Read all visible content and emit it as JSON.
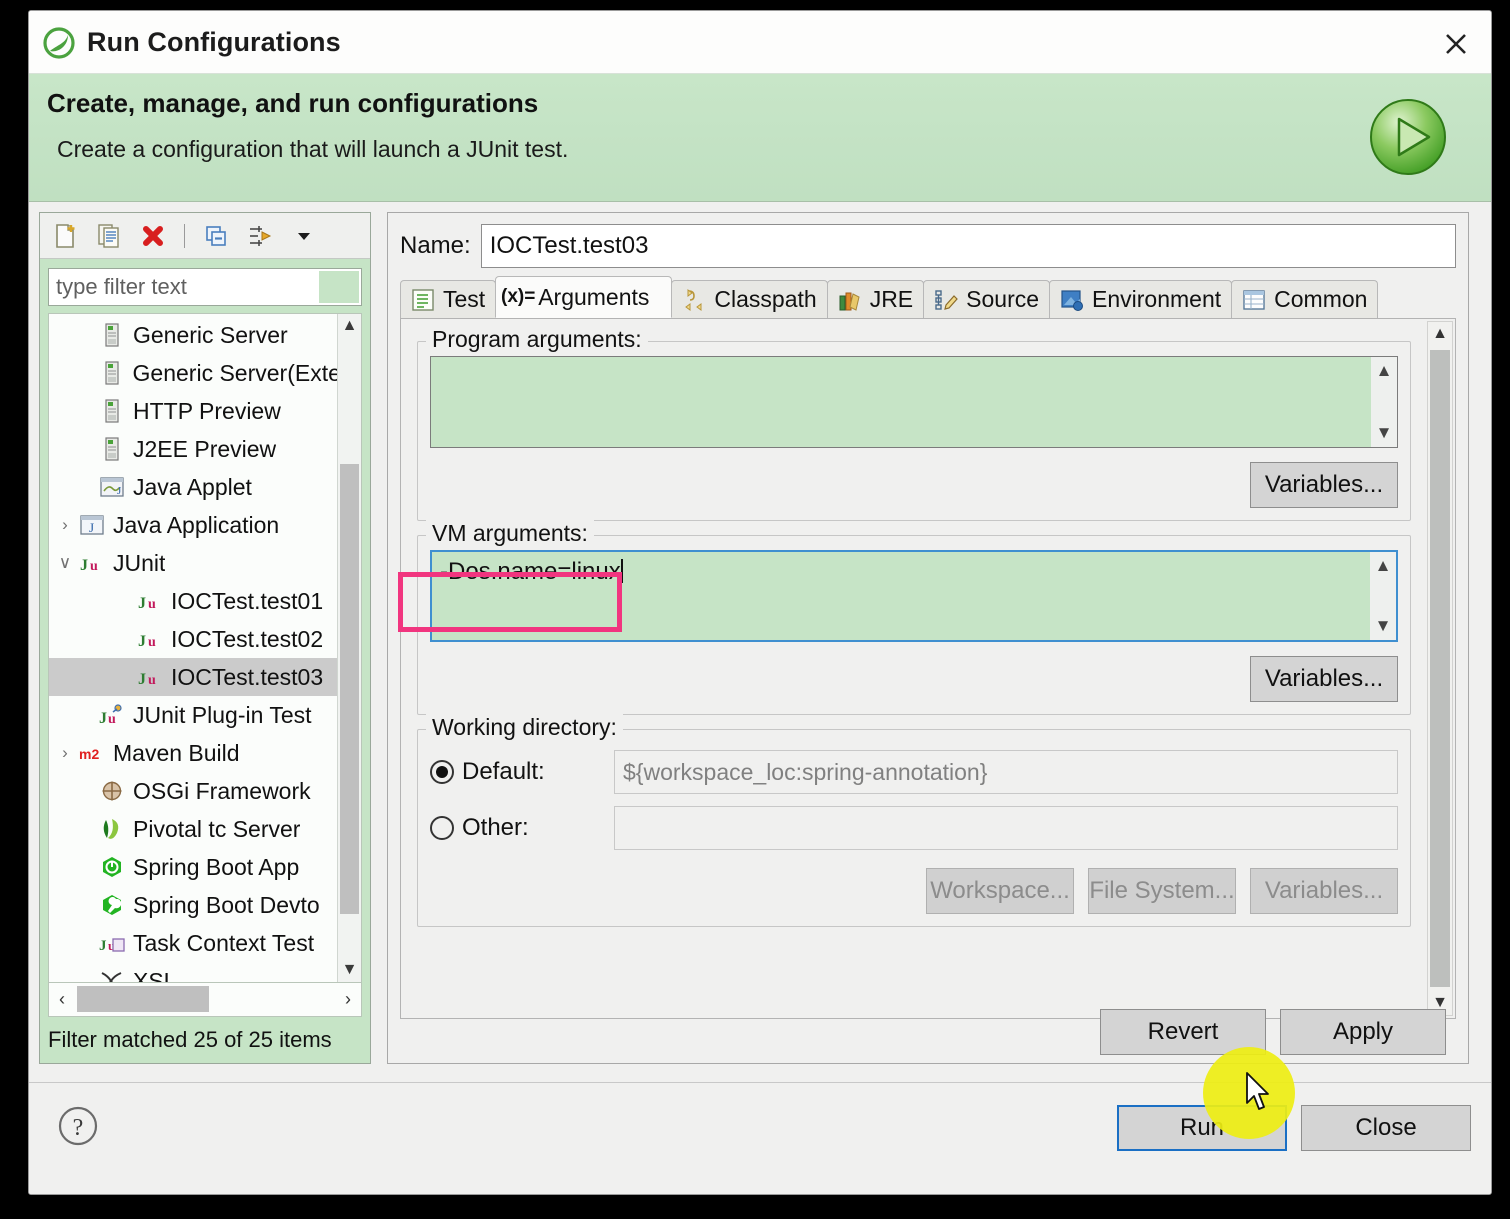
{
  "window": {
    "title": "Run Configurations",
    "logo_icon": "spring-leaf-icon",
    "close_icon": "close-icon"
  },
  "banner": {
    "heading": "Create, manage, and run configurations",
    "subheading": "Create a configuration that will launch a JUnit test.",
    "badge_icon": "run-play-icon",
    "bg_color": "#c4e2c4"
  },
  "left_pane": {
    "toolbar": [
      {
        "name": "new-configuration-icon",
        "label": "New"
      },
      {
        "name": "duplicate-configuration-icon",
        "label": "Duplicate"
      },
      {
        "name": "delete-configuration-icon",
        "label": "Delete"
      },
      {
        "name": "collapse-all-icon",
        "label": "Collapse All"
      },
      {
        "name": "filter-icon",
        "label": "Filter"
      },
      {
        "name": "chevron-down-icon",
        "label": "Menu"
      }
    ],
    "filter": {
      "placeholder": "type filter text",
      "value": ""
    },
    "tree": [
      {
        "label": "Generic Server",
        "icon": "server-icon",
        "indent": 1,
        "twisty": "",
        "selected": false
      },
      {
        "label": "Generic Server(Exte",
        "icon": "server-icon",
        "indent": 1,
        "twisty": "",
        "selected": false
      },
      {
        "label": "HTTP Preview",
        "icon": "server-icon",
        "indent": 1,
        "twisty": "",
        "selected": false
      },
      {
        "label": "J2EE Preview",
        "icon": "server-icon",
        "indent": 1,
        "twisty": "",
        "selected": false
      },
      {
        "label": "Java Applet",
        "icon": "java-applet-icon",
        "indent": 1,
        "twisty": "",
        "selected": false
      },
      {
        "label": "Java Application",
        "icon": "java-application-icon",
        "indent": 0,
        "twisty": "›",
        "selected": false
      },
      {
        "label": "JUnit",
        "icon": "junit-icon",
        "indent": 0,
        "twisty": "∨",
        "selected": false
      },
      {
        "label": "IOCTest.test01",
        "icon": "junit-icon",
        "indent": 2,
        "twisty": "",
        "selected": false
      },
      {
        "label": "IOCTest.test02",
        "icon": "junit-icon",
        "indent": 2,
        "twisty": "",
        "selected": false
      },
      {
        "label": "IOCTest.test03",
        "icon": "junit-icon",
        "indent": 2,
        "twisty": "",
        "selected": true
      },
      {
        "label": "JUnit Plug-in Test",
        "icon": "junit-plugin-icon",
        "indent": 1,
        "twisty": "",
        "selected": false
      },
      {
        "label": "Maven Build",
        "icon": "maven-icon",
        "indent": 0,
        "twisty": "›",
        "selected": false
      },
      {
        "label": "OSGi Framework",
        "icon": "osgi-icon",
        "indent": 1,
        "twisty": "",
        "selected": false
      },
      {
        "label": "Pivotal tc Server",
        "icon": "pivotal-icon",
        "indent": 1,
        "twisty": "",
        "selected": false
      },
      {
        "label": "Spring Boot App",
        "icon": "spring-boot-icon",
        "indent": 1,
        "twisty": "",
        "selected": false
      },
      {
        "label": "Spring Boot Devto",
        "icon": "spring-devtools-icon",
        "indent": 1,
        "twisty": "",
        "selected": false
      },
      {
        "label": "Task Context Test",
        "icon": "task-context-icon",
        "indent": 1,
        "twisty": "",
        "selected": false
      },
      {
        "label": "XSL",
        "icon": "xsl-icon",
        "indent": 1,
        "twisty": "",
        "selected": false
      }
    ],
    "status": "Filter matched 25 of 25 items"
  },
  "right_pane": {
    "name_label": "Name:",
    "name_value": "IOCTest.test03",
    "tabs": [
      {
        "label": "Test",
        "icon": "test-icon",
        "active": false
      },
      {
        "label": "Arguments",
        "icon": "variable-xy-icon",
        "active": true
      },
      {
        "label": "Classpath",
        "icon": "classpath-icon",
        "active": false
      },
      {
        "label": "JRE",
        "icon": "jre-books-icon",
        "active": false
      },
      {
        "label": "Source",
        "icon": "source-pencil-icon",
        "active": false
      },
      {
        "label": "Environment",
        "icon": "environment-icon",
        "active": false
      },
      {
        "label": "Common",
        "icon": "common-table-icon",
        "active": false
      }
    ],
    "program_arguments": {
      "group_label": "Program arguments:",
      "value": "",
      "variables_button": "Variables..."
    },
    "vm_arguments": {
      "group_label": "VM arguments:",
      "value": "-Dos.name=linux",
      "variables_button": "Variables...",
      "highlight_color": "#f1357f",
      "focused": true
    },
    "working_directory": {
      "group_label": "Working directory:",
      "default_label": "Default:",
      "default_value": "${workspace_loc:spring-annotation}",
      "default_selected": true,
      "other_label": "Other:",
      "other_value": "",
      "other_selected": false,
      "workspace_button": "Workspace...",
      "file_system_button": "File System...",
      "variables_button": "Variables..."
    },
    "revert_button": "Revert",
    "apply_button": "Apply"
  },
  "footer": {
    "help_icon": "help-question-icon",
    "run_button": "Run",
    "close_button": "Close"
  },
  "annotations": {
    "cursor_icon": "mouse-pointer-icon",
    "click_highlight_color": "#eeee12"
  }
}
